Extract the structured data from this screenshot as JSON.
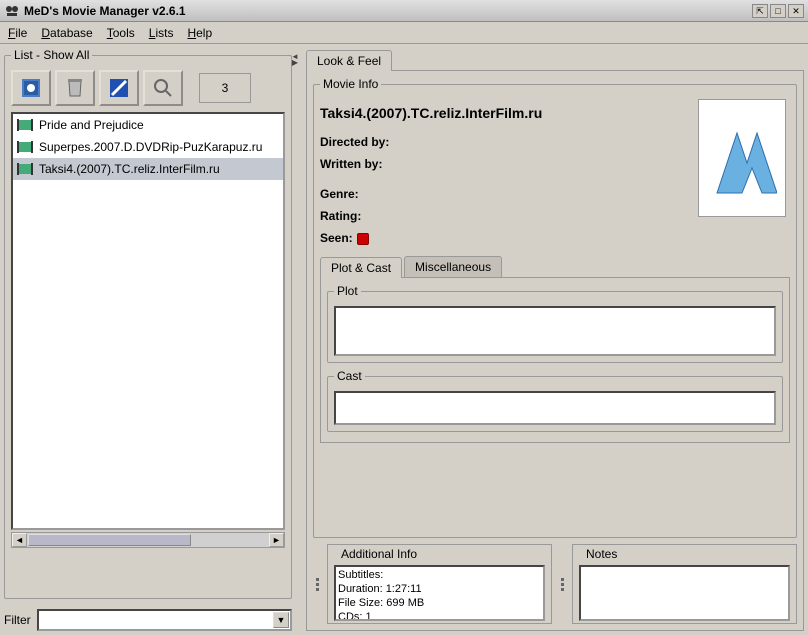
{
  "window": {
    "title": "MeD's Movie Manager v2.6.1"
  },
  "menu": {
    "file": "File",
    "database": "Database",
    "tools": "Tools",
    "lists": "Lists",
    "help": "Help"
  },
  "left": {
    "group_title": "List - Show All",
    "count": "3",
    "items": [
      {
        "label": "Pride and Prejudice",
        "selected": false
      },
      {
        "label": "Superpes.2007.D.DVDRip-PuzKarapuz.ru",
        "selected": false
      },
      {
        "label": "Taksi4.(2007).TC.reliz.InterFilm.ru",
        "selected": true
      }
    ],
    "filter_label": "Filter"
  },
  "right": {
    "tab_look_feel": "Look & Feel",
    "movie_info_label": "Movie Info",
    "title": "Taksi4.(2007).TC.reliz.InterFilm.ru",
    "directed_label": "Directed by:",
    "written_label": "Written by:",
    "genre_label": "Genre:",
    "rating_label": "Rating:",
    "seen_label": "Seen:",
    "tab_plot": "Plot & Cast",
    "tab_misc": "Miscellaneous",
    "plot_label": "Plot",
    "cast_label": "Cast",
    "addl_label": "Additional Info",
    "notes_label": "Notes",
    "addl": {
      "subtitles": "Subtitles:",
      "duration": "Duration: 1:27:11",
      "filesize": "File Size: 699 MB",
      "cds": "CDs: 1"
    }
  }
}
